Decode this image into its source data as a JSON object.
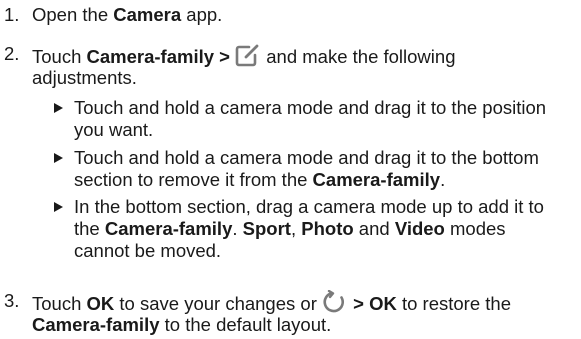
{
  "steps": [
    {
      "number": "1.",
      "parts": [
        "Open the ",
        "Camera",
        " app."
      ]
    },
    {
      "number": "2.",
      "parts": [
        "Touch ",
        "Camera-family >",
        "and make the following",
        "adjustments."
      ],
      "icon": "edit-icon",
      "bullets": [
        {
          "line1": "Touch and hold a camera mode and drag it to the position",
          "line2": "you want."
        },
        {
          "line1": "Touch and hold a camera mode and drag it to the bottom",
          "line2_a": "section to remove it from the ",
          "line2_b": "Camera-family",
          "line2_c": "."
        },
        {
          "line1": "In the bottom section, drag a camera mode up to add it to",
          "line2_a": "the ",
          "line2_b": "Camera-family",
          "line2_c": ". ",
          "line2_d": "Sport",
          "line2_e": ", ",
          "line2_f": "Photo",
          "line2_g": " and ",
          "line2_h": "Video",
          "line2_i": " modes",
          "line3": "cannot be moved."
        }
      ]
    },
    {
      "number": "3.",
      "parts": [
        "Touch ",
        "OK",
        " to save your changes or",
        "> OK",
        " to restore the",
        "Camera-family",
        " to the default layout."
      ],
      "icon": "restore-icon"
    }
  ]
}
